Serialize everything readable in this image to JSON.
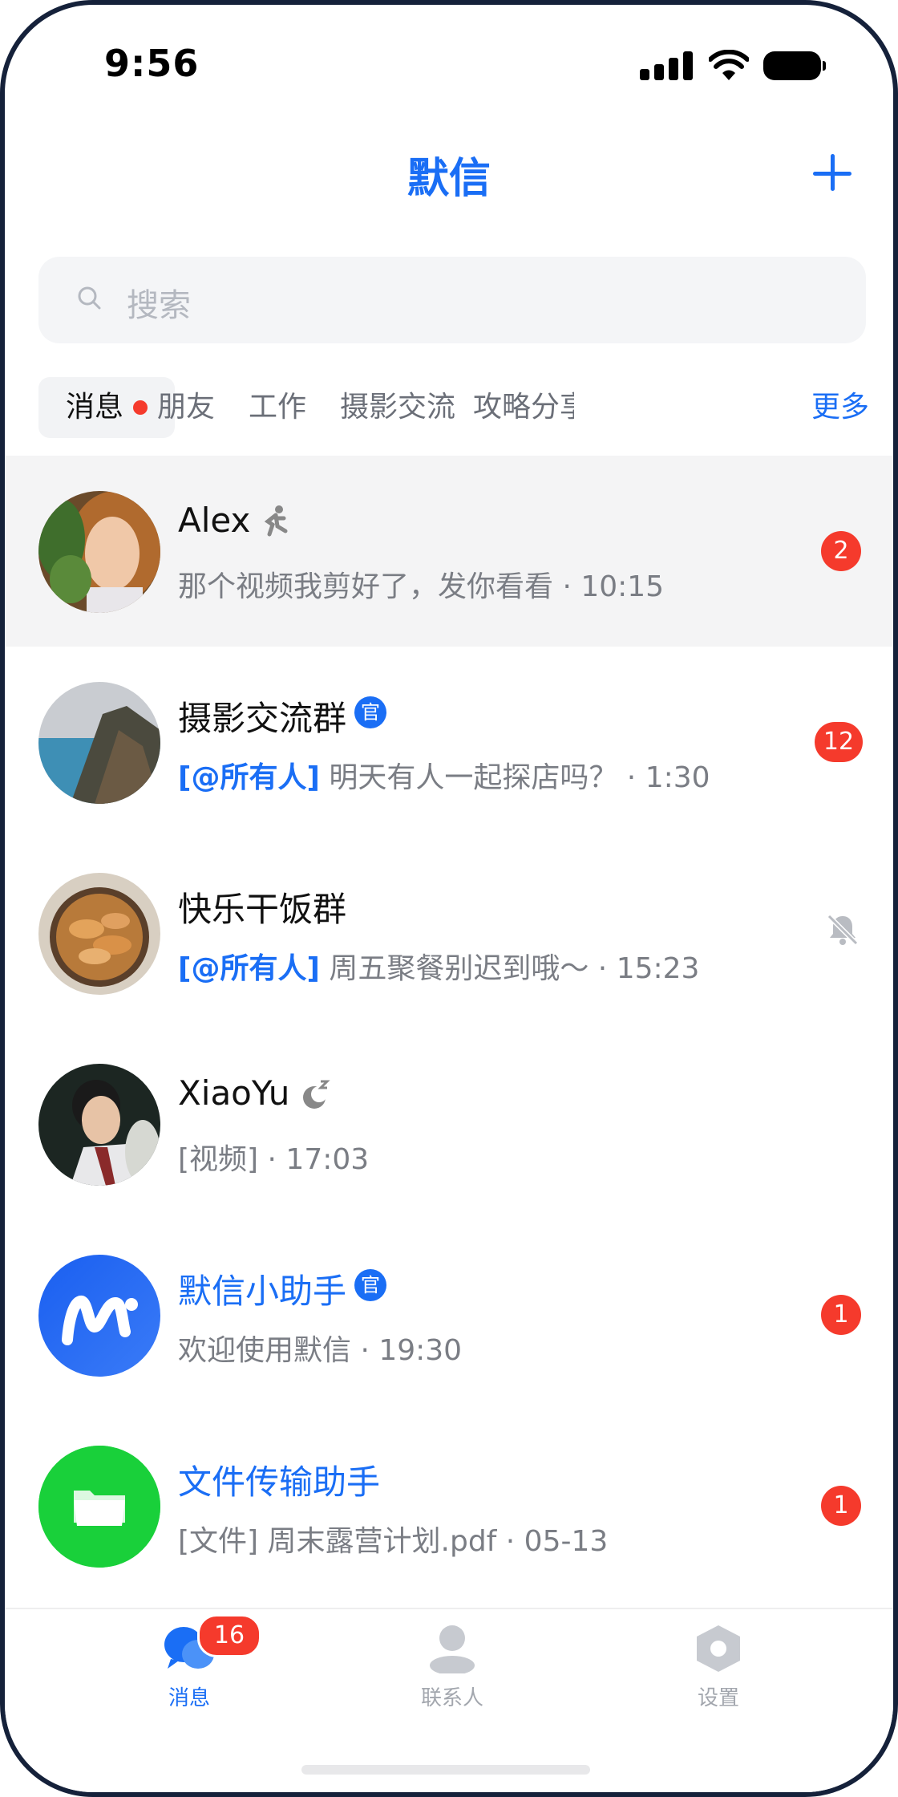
{
  "status_bar": {
    "time": "9:56"
  },
  "header": {
    "title": "默信"
  },
  "search": {
    "placeholder": "搜索"
  },
  "tabs": {
    "items": [
      {
        "label": "消息",
        "active": true,
        "has_dot": true
      },
      {
        "label": "朋友"
      },
      {
        "label": "工作"
      },
      {
        "label": "摄影交流"
      },
      {
        "label": "攻略分享"
      }
    ],
    "more": "更多"
  },
  "chats": [
    {
      "name": "Alex",
      "status_icon": "running-person-icon",
      "preview": "那个视频我剪好了，发你看看 · 10:15",
      "badge": "2",
      "highlighted": true
    },
    {
      "name": "摄影交流群",
      "official_badge": "官",
      "mention": "[@所有人]",
      "preview": " 明天有人一起探店吗？ · 1:30",
      "badge": "12"
    },
    {
      "name": "快乐干饭群",
      "mention": "[@所有人]",
      "preview": " 周五聚餐别迟到哦～ · 15:23",
      "muted": true
    },
    {
      "name": "XiaoYu",
      "status_icon": "sleeping-moon-icon",
      "preview": "[视频] · 17:03"
    },
    {
      "name": "默信小助手",
      "official_badge": "官",
      "preview": "欢迎使用默信 · 19:30",
      "badge": "1"
    },
    {
      "name": "文件传输助手",
      "preview": "[文件] 周末露营计划.pdf · 05-13",
      "badge": "1"
    }
  ],
  "bottom_nav": {
    "items": [
      {
        "label": "消息",
        "icon": "chat-bubbles-icon",
        "active": true,
        "badge": "16"
      },
      {
        "label": "联系人",
        "icon": "person-icon"
      },
      {
        "label": "设置",
        "icon": "hexagon-gear-icon"
      }
    ]
  },
  "colors": {
    "accent": "#1a6ef5",
    "badge": "#f53a2c",
    "green": "#19d03a"
  }
}
